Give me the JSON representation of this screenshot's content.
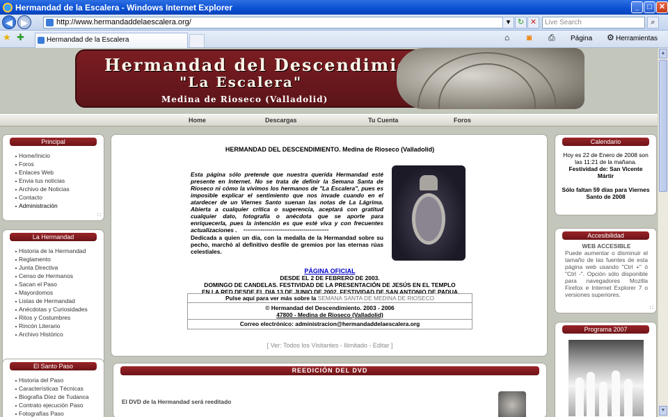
{
  "window": {
    "title": "Hermandad de la Escalera - Windows Internet Explorer",
    "minimize_glyph": "_",
    "maximize_glyph": "□",
    "close_glyph": "✕"
  },
  "browser": {
    "url": "http://www.hermandaddelaescalera.org/",
    "search_placeholder": "Live Search",
    "tab_title": "Hermandad de la Escalera",
    "tools": {
      "page": "Página",
      "tools": "Herramientas"
    }
  },
  "banner": {
    "title_line1": "Hermandad del Descendimiento",
    "title_line2": "\"La Escalera\"",
    "subtitle": "Medina de Rioseco (Valladolid)"
  },
  "nav": [
    "Home",
    "Descargas",
    "Tu Cuenta",
    "Foros"
  ],
  "sidebar_left": {
    "principal": {
      "title": "Principal",
      "items": [
        "Home/Inicio",
        "Foros",
        "Enlaces Web",
        "Envia tus noticias",
        "Archivo de Noticias",
        "Contacto",
        "Administración"
      ]
    },
    "hermandad": {
      "title": "La Hermandad",
      "items": [
        "Historia de la Hermandad",
        "Reglamento",
        "Junta Directiva",
        "Censo de Hermanos",
        "Sacan el Paso",
        "Mayordomos",
        "Listas de Hermandad",
        "Anécdotas y Curiosidades",
        "Ritos y Costumbres",
        "Rincón Literario",
        "Archivo Histórico"
      ]
    },
    "paso": {
      "title": "El Santo Paso",
      "items": [
        "Historia del Paso",
        "Características Técnicas",
        "Biografía Díez de Tudanca",
        "Contrato ejecución Paso",
        "Fotografías Paso"
      ]
    }
  },
  "main": {
    "title": "HERMANDAD DEL DESCENDIMIENTO. Medina de Rioseco (Valladolid)",
    "intro": "Esta página sólo pretende que nuestra querida Hermandad esté presente en Internet. No se trata de definir la Semana Santa de Rioseco ni cómo la vivimos los hermanos de \"La Escalera\", pues es imposible explicar el sentimiento que nos invade cuando en el atardecer de un Viernes Santo suenan las notas de La Lágrima. Abierta a cualquier crítica o sugerencia, aceptará con gratitud cualquier dato, fotografía o anécdota que se aporte para enriquecerla, pues la intención es que esté viva y con frecuentes actualizaciones .",
    "separator": "--------------------------------------------",
    "dedication": "Dedicada a quien un día, con la medalla de la Hermandad sobre su pecho, marchó al definitivo desfile de gremios por las eternas rúas celestiales.",
    "official_link": "PÁGINA OFICIAL",
    "date_lines": [
      "DESDE EL 2 DE FEBRERO DE 2003.",
      "DOMINGO DE CANDELAS. FESTIVIDAD DE LA PRESENTACIÓN DE JESÚS EN EL TEMPLO",
      "EN LA RED DESDE EL DIA 13 DE JUNIO DE 2002. FESTIVIDAD DE SAN ANTONIO DE PADUA"
    ],
    "info": {
      "semana_prefix": "Pulse aquí para ver más sobre la",
      "semana_link": "SEMANA SANTA DE MEDINA DE RIOSECO",
      "copyright": "© Hermandad del Descendimiento. 2003 - 2006",
      "address": "47800 - Medina de Rioseco (Valladolid)",
      "email": "Correo electrónico: administracion@hermandaddelaescalera.org"
    },
    "visitors": "[ Ver: Todos los Visitantes - Ilimitado - Editar ]"
  },
  "dvd": {
    "title": "REEDICIÓN DEL DVD",
    "text": "El DVD de la Hermandad será reeditado"
  },
  "sidebar_right": {
    "calendar": {
      "title": "Calendario",
      "today": "Hoy es 22 de Enero de 2008 son las 11:21 de la mañana.",
      "festivity": "Festividad de: San Vicente Mártir",
      "countdown": "Sólo faltan 59 días para Viernes Santo de 2008"
    },
    "accessibility": {
      "title": "Accesibilidad",
      "heading": "WEB ACCESIBLE",
      "text": "Puede aumentar o disminuir el tamaño de las fuentes de esta página web usando \"Ctrl +\" ó \"Ctrl -\". Opción sólo disponible para navegadores Mozilla Firefox e Internet Explorer 7 o versiones superiores."
    },
    "program": {
      "title": "Programa 2007"
    }
  }
}
